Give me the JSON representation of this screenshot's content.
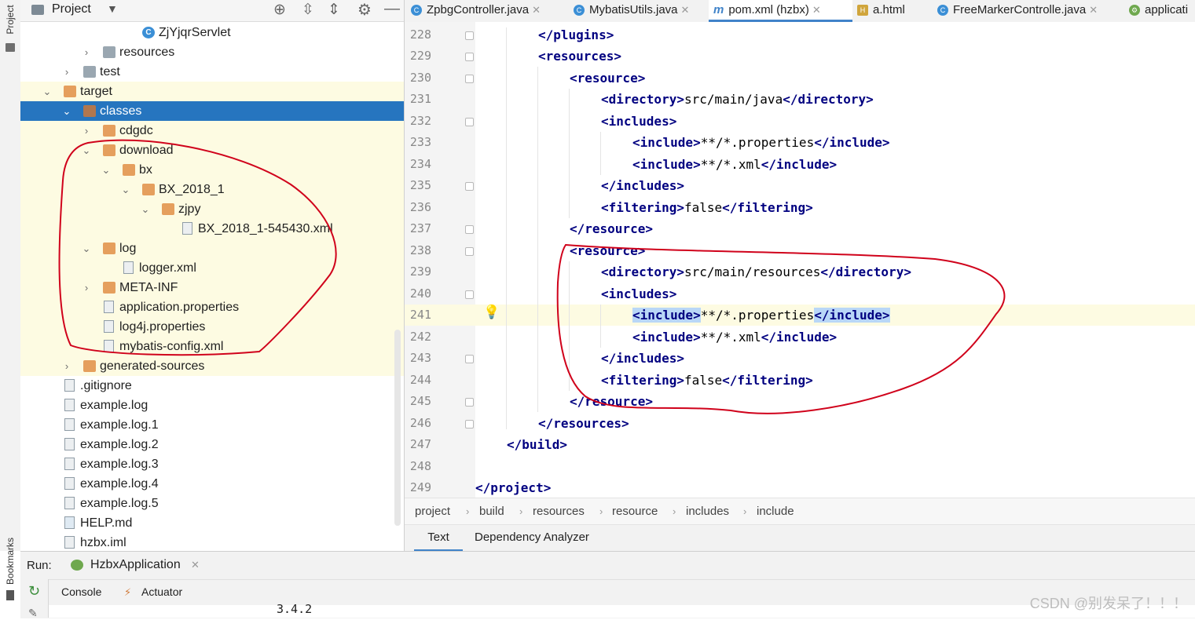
{
  "sidebar": {
    "project_label": "Project",
    "bookmarks_label": "Bookmarks"
  },
  "project_panel": {
    "title": "Project",
    "tree": [
      {
        "label": "ZjYjqrServlet",
        "icon": "java-class-icon"
      },
      {
        "label": "resources",
        "icon": "resources-folder-icon"
      },
      {
        "label": "test",
        "icon": "folder-icon"
      },
      {
        "label": "target",
        "icon": "folder-icon"
      },
      {
        "label": "classes",
        "icon": "folder-icon"
      },
      {
        "label": "cdgdc",
        "icon": "folder-icon"
      },
      {
        "label": "download",
        "icon": "folder-icon"
      },
      {
        "label": "bx",
        "icon": "folder-icon"
      },
      {
        "label": "BX_2018_1",
        "icon": "folder-icon"
      },
      {
        "label": "zjpy",
        "icon": "folder-icon"
      },
      {
        "label": "BX_2018_1-545430.xml",
        "icon": "xml-file-icon"
      },
      {
        "label": "log",
        "icon": "folder-icon"
      },
      {
        "label": "logger.xml",
        "icon": "xml-file-icon"
      },
      {
        "label": "META-INF",
        "icon": "folder-icon"
      },
      {
        "label": "application.properties",
        "icon": "properties-file-icon"
      },
      {
        "label": "log4j.properties",
        "icon": "properties-file-icon"
      },
      {
        "label": "mybatis-config.xml",
        "icon": "xml-file-icon"
      },
      {
        "label": "generated-sources",
        "icon": "folder-icon"
      },
      {
        "label": ".gitignore",
        "icon": "file-icon"
      },
      {
        "label": "example.log",
        "icon": "file-icon"
      },
      {
        "label": "example.log.1",
        "icon": "file-icon"
      },
      {
        "label": "example.log.2",
        "icon": "file-icon"
      },
      {
        "label": "example.log.3",
        "icon": "file-icon"
      },
      {
        "label": "example.log.4",
        "icon": "file-icon"
      },
      {
        "label": "example.log.5",
        "icon": "file-icon"
      },
      {
        "label": "HELP.md",
        "icon": "markdown-file-icon"
      },
      {
        "label": "hzbx.iml",
        "icon": "file-icon"
      }
    ]
  },
  "editor": {
    "tabs": [
      {
        "label": "ZpbgController.java",
        "active": false
      },
      {
        "label": "MybatisUtils.java",
        "active": false
      },
      {
        "label": "pom.xml (hzbx)",
        "active": true
      },
      {
        "label": "a.html",
        "active": false
      },
      {
        "label": "FreeMarkerControlle.java",
        "active": false
      },
      {
        "label": "applicati",
        "active": false
      }
    ],
    "lines": [
      {
        "num": "228",
        "tag1": "</plugins>",
        "text": "",
        "tag2": ""
      },
      {
        "num": "229",
        "tag1": "<resources>",
        "text": "",
        "tag2": ""
      },
      {
        "num": "230",
        "tag1": "<resource>",
        "text": "",
        "tag2": ""
      },
      {
        "num": "231",
        "tag1": "<directory>",
        "text": "src/main/java",
        "tag2": "</directory>"
      },
      {
        "num": "232",
        "tag1": "<includes>",
        "text": "",
        "tag2": ""
      },
      {
        "num": "233",
        "tag1": "<include>",
        "text": "**/*.properties",
        "tag2": "</include>"
      },
      {
        "num": "234",
        "tag1": "<include>",
        "text": "**/*.xml",
        "tag2": "</include>"
      },
      {
        "num": "235",
        "tag1": "</includes>",
        "text": "",
        "tag2": ""
      },
      {
        "num": "236",
        "tag1": "<filtering>",
        "text": "false",
        "tag2": "</filtering>"
      },
      {
        "num": "237",
        "tag1": "</resource>",
        "text": "",
        "tag2": ""
      },
      {
        "num": "238",
        "tag1": "<resource>",
        "text": "",
        "tag2": ""
      },
      {
        "num": "239",
        "tag1": "<directory>",
        "text": "src/main/resources",
        "tag2": "</directory>"
      },
      {
        "num": "240",
        "tag1": "<includes>",
        "text": "",
        "tag2": ""
      },
      {
        "num": "241",
        "tag1": "<include>",
        "text": "**/*.properties",
        "tag2": "</include>"
      },
      {
        "num": "242",
        "tag1": "<include>",
        "text": "**/*.xml",
        "tag2": "</include>"
      },
      {
        "num": "243",
        "tag1": "</includes>",
        "text": "",
        "tag2": ""
      },
      {
        "num": "244",
        "tag1": "<filtering>",
        "text": "false",
        "tag2": "</filtering>"
      },
      {
        "num": "245",
        "tag1": "</resource>",
        "text": "",
        "tag2": ""
      },
      {
        "num": "246",
        "tag1": "</resources>",
        "text": "",
        "tag2": ""
      },
      {
        "num": "247",
        "tag1": "</build>",
        "text": "",
        "tag2": ""
      },
      {
        "num": "248",
        "tag1": "",
        "text": "",
        "tag2": ""
      },
      {
        "num": "249",
        "tag1": "</project>",
        "text": "",
        "tag2": ""
      }
    ],
    "breadcrumbs": [
      "project",
      "build",
      "resources",
      "resource",
      "includes",
      "include"
    ],
    "bottom_tabs": [
      {
        "label": "Text",
        "active": true
      },
      {
        "label": "Dependency Analyzer",
        "active": false
      }
    ]
  },
  "run_panel": {
    "label": "Run:",
    "config_name": "HzbxApplication",
    "tabs": [
      "Console",
      "Actuator"
    ],
    "console_output": "3.4.2"
  },
  "watermark": "CSDN @别发呆了！！！",
  "colors": {
    "selection": "#2675bf",
    "highlight_row": "#fdfbe2",
    "xml_tag": "#000080",
    "annotation": "#d0021b"
  }
}
